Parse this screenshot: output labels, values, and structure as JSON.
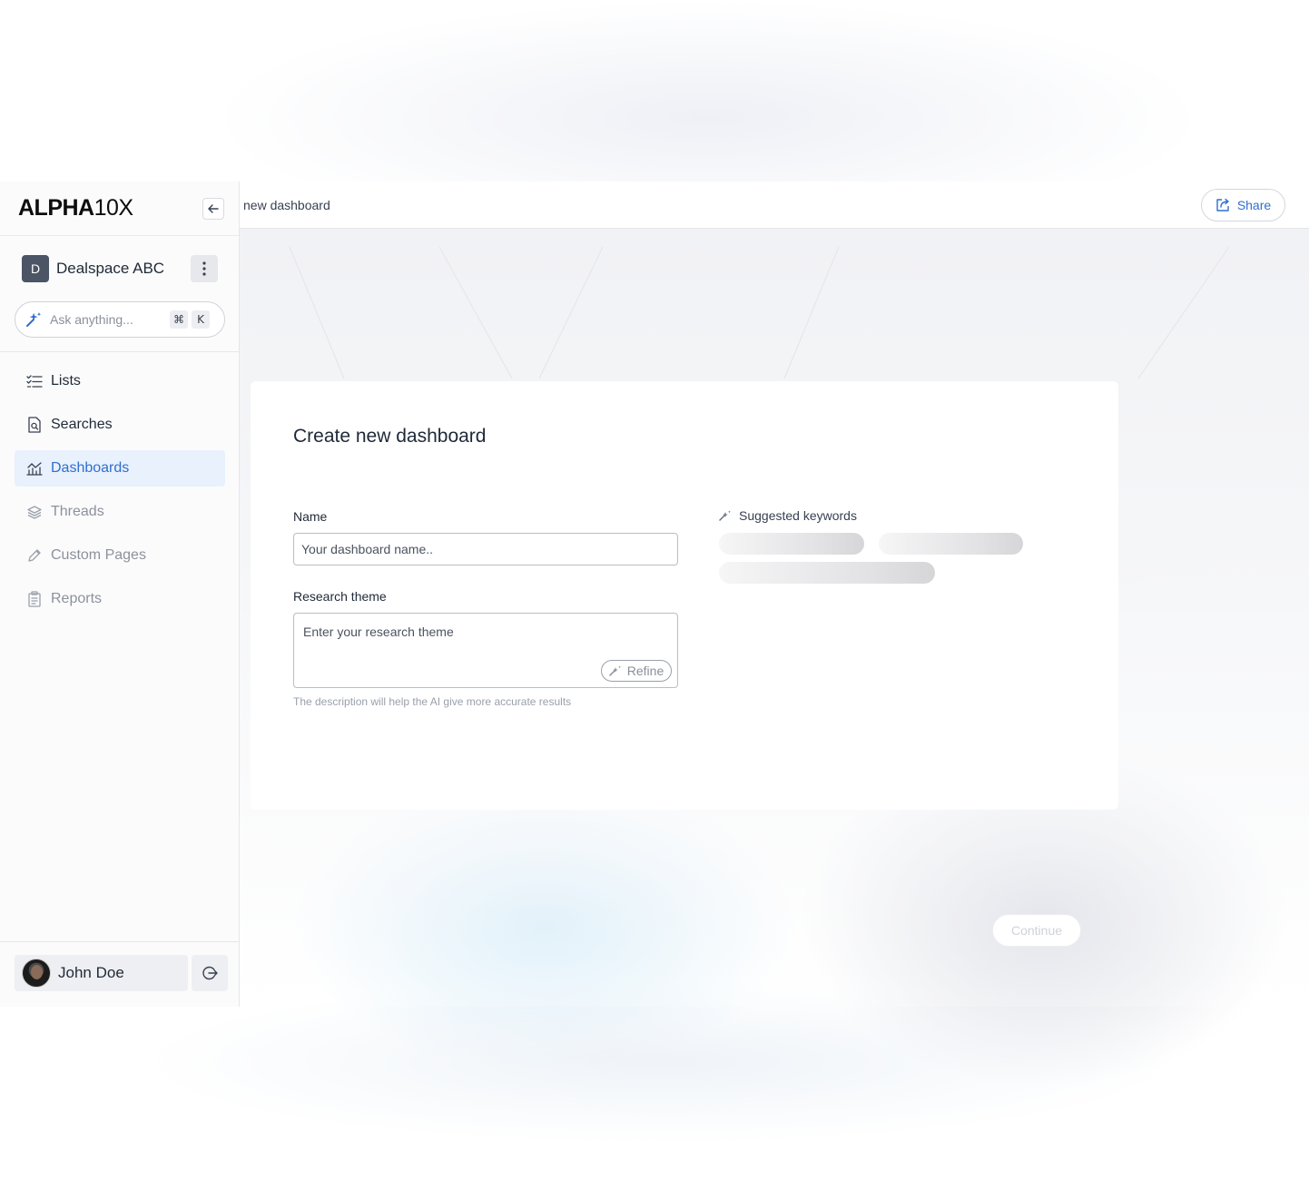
{
  "brand": {
    "logo_bold": "ALPHA",
    "logo_light": "10X"
  },
  "workspace": {
    "initial": "D",
    "name": "Dealspace ABC"
  },
  "search": {
    "placeholder": "Ask anything...",
    "shortcut_cmd": "⌘",
    "shortcut_key": "K"
  },
  "nav": {
    "items": [
      {
        "label": "Lists",
        "icon": "list-check-icon",
        "state": "normal"
      },
      {
        "label": "Searches",
        "icon": "document-search-icon",
        "state": "normal"
      },
      {
        "label": "Dashboards",
        "icon": "chart-line-icon",
        "state": "active"
      },
      {
        "label": "Threads",
        "icon": "layers-icon",
        "state": "muted"
      },
      {
        "label": "Custom Pages",
        "icon": "pencil-icon",
        "state": "muted"
      },
      {
        "label": "Reports",
        "icon": "clipboard-icon",
        "state": "muted"
      }
    ]
  },
  "user": {
    "name": "John Doe"
  },
  "header": {
    "breadcrumb": "new dashboard",
    "share_label": "Share"
  },
  "form": {
    "title": "Create new dashboard",
    "name_label": "Name",
    "name_placeholder": "Your dashboard name..",
    "theme_label": "Research theme",
    "theme_placeholder": "Enter your research theme",
    "refine_label": "Refine",
    "helper_text": "The description will help the AI give more accurate results",
    "suggested_title": "Suggested keywords",
    "continue_label": "Continue"
  },
  "colors": {
    "accent": "#2f6fcf",
    "active_nav_bg": "#e8f1fc",
    "workspace_badge": "#4b5565"
  }
}
